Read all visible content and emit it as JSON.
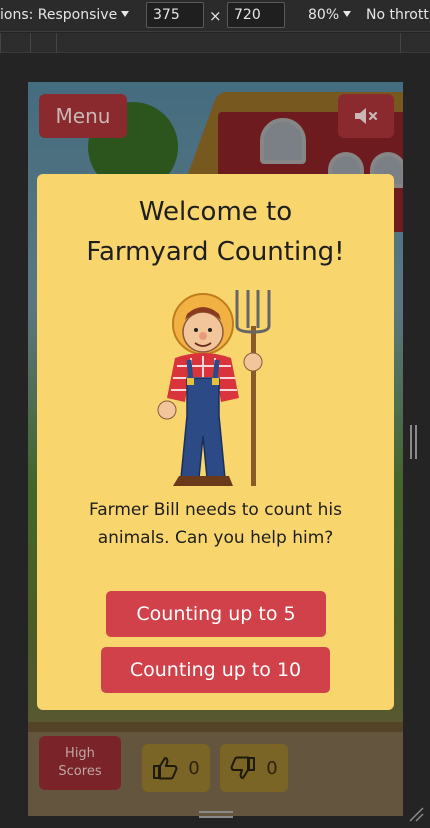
{
  "devtools": {
    "dimensions_label": "ions: Responsive",
    "width_value": "375",
    "height_value": "720",
    "times": "×",
    "zoom": "80%",
    "throttle": "No thrott"
  },
  "app": {
    "menu_label": "Menu",
    "mute_icon": "speaker-muted-icon",
    "modal": {
      "title_line1": "Welcome to",
      "title_line2": "Farmyard Counting!",
      "text_line1": "Farmer Bill needs to count his",
      "text_line2": "animals. Can you help him?",
      "button_5": "Counting up to 5",
      "button_10": "Counting up to 10"
    },
    "high_scores_line1": "High",
    "high_scores_line2": "Scores",
    "thumbs_up_count": "0",
    "thumbs_down_count": "0"
  },
  "colors": {
    "modal_bg": "#f8d56d",
    "button_red": "#d0414a",
    "menu_red_dimmed": "#8a2a2f"
  }
}
